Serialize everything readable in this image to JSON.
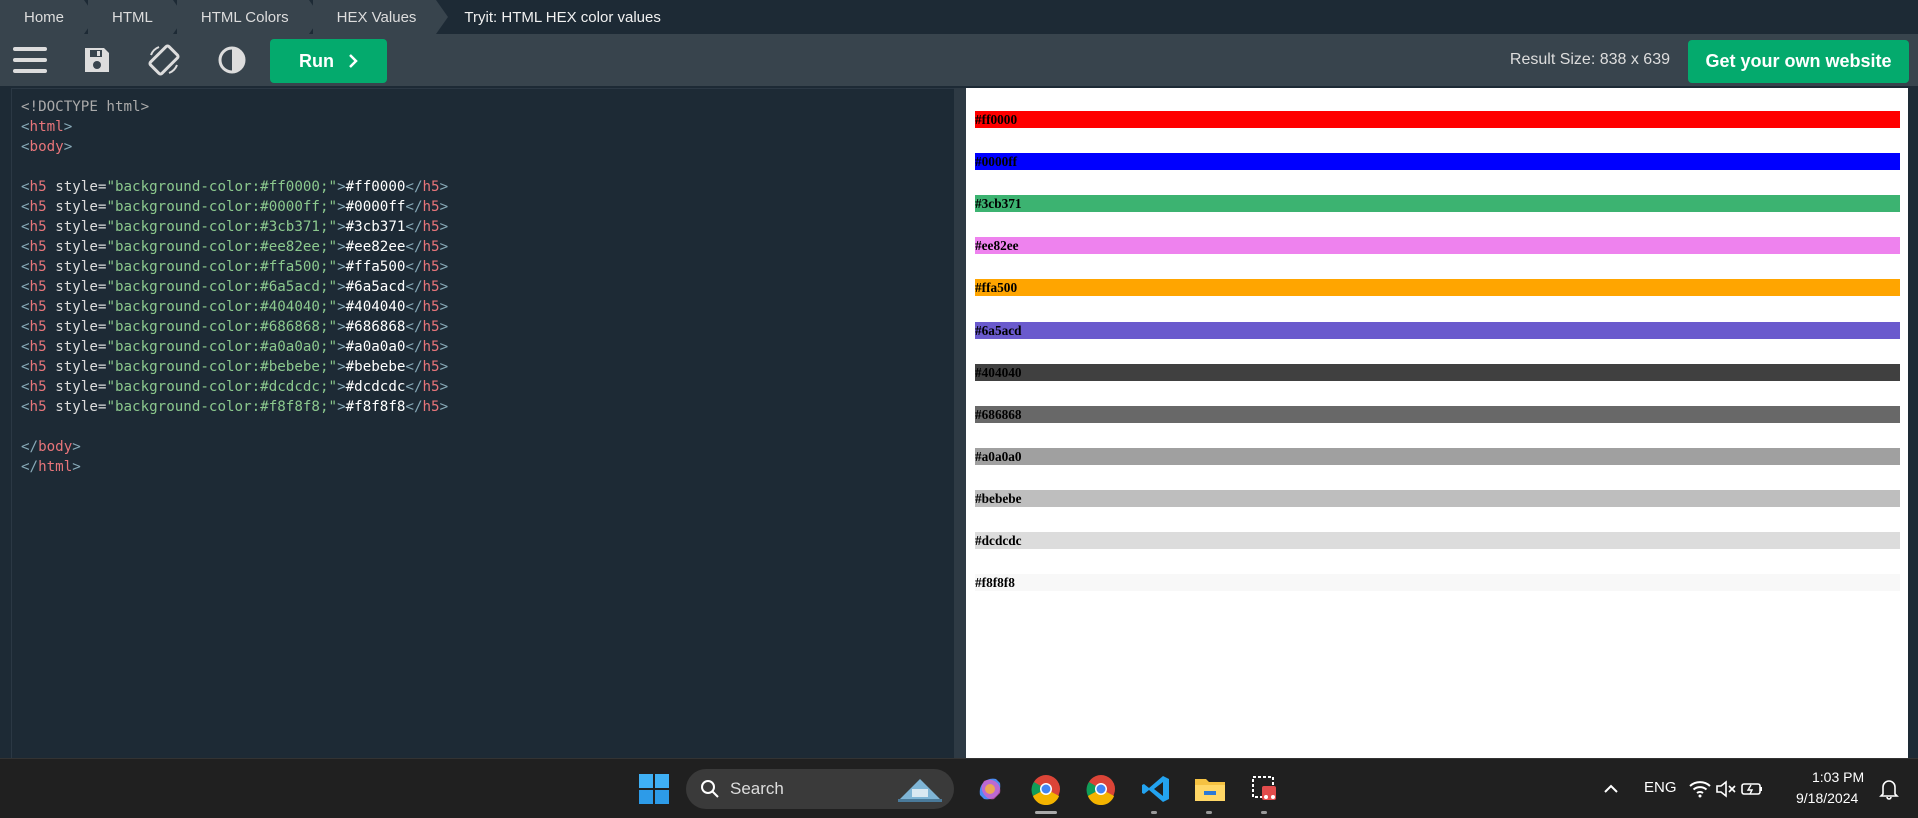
{
  "breadcrumb": [
    "Home",
    "HTML",
    "HTML Colors",
    "HEX Values",
    "Tryit: HTML HEX color values"
  ],
  "toolbar": {
    "run_label": "Run",
    "result_size": "Result Size: 838 x 639",
    "own_website": "Get your own website"
  },
  "code": {
    "doctype": "<!DOCTYPE html>",
    "html_open": "html",
    "body_open": "body",
    "body_close": "body",
    "html_close": "html",
    "h5_tag": "h5",
    "attr": "style=",
    "lines": [
      {
        "style": "\"background-color:#ff0000;\"",
        "text": "#ff0000"
      },
      {
        "style": "\"background-color:#0000ff;\"",
        "text": "#0000ff"
      },
      {
        "style": "\"background-color:#3cb371;\"",
        "text": "#3cb371"
      },
      {
        "style": "\"background-color:#ee82ee;\"",
        "text": "#ee82ee"
      },
      {
        "style": "\"background-color:#ffa500;\"",
        "text": "#ffa500"
      },
      {
        "style": "\"background-color:#6a5acd;\"",
        "text": "#6a5acd"
      },
      {
        "style": "\"background-color:#404040;\"",
        "text": "#404040"
      },
      {
        "style": "\"background-color:#686868;\"",
        "text": "#686868"
      },
      {
        "style": "\"background-color:#a0a0a0;\"",
        "text": "#a0a0a0"
      },
      {
        "style": "\"background-color:#bebebe;\"",
        "text": "#bebebe"
      },
      {
        "style": "\"background-color:#dcdcdc;\"",
        "text": "#dcdcdc"
      },
      {
        "style": "\"background-color:#f8f8f8;\"",
        "text": "#f8f8f8"
      }
    ]
  },
  "result": {
    "rows": [
      {
        "label": "#ff0000",
        "color": "#ff0000"
      },
      {
        "label": "#0000ff",
        "color": "#0000ff"
      },
      {
        "label": "#3cb371",
        "color": "#3cb371"
      },
      {
        "label": "#ee82ee",
        "color": "#ee82ee"
      },
      {
        "label": "#ffa500",
        "color": "#ffa500"
      },
      {
        "label": "#6a5acd",
        "color": "#6a5acd"
      },
      {
        "label": "#404040",
        "color": "#404040"
      },
      {
        "label": "#686868",
        "color": "#686868"
      },
      {
        "label": "#a0a0a0",
        "color": "#a0a0a0"
      },
      {
        "label": "#bebebe",
        "color": "#bebebe"
      },
      {
        "label": "#dcdcdc",
        "color": "#dcdcdc"
      },
      {
        "label": "#f8f8f8",
        "color": "#f8f8f8"
      }
    ]
  },
  "taskbar": {
    "search_label": "Search",
    "lang": "ENG",
    "time": "1:03 PM",
    "date": "9/18/2024",
    "icons": [
      "windows-start-icon",
      "copilot-icon",
      "chrome-icon",
      "chrome-profile-icon",
      "vscode-icon",
      "file-explorer-icon",
      "snipping-tool-icon"
    ]
  },
  "colors": {
    "accent": "#04aa6d",
    "editor_bg": "#1d2a35",
    "toolbar_bg": "#38444d"
  }
}
